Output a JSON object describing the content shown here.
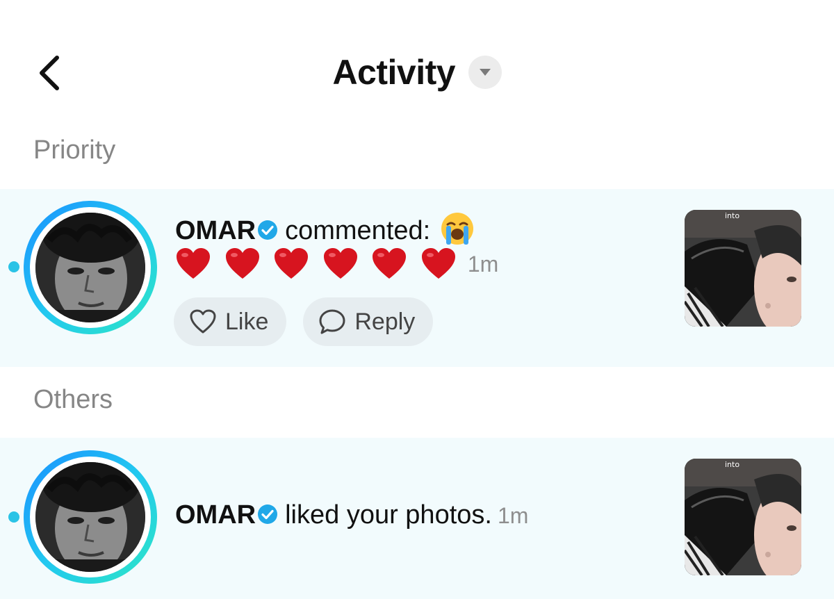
{
  "header": {
    "title": "Activity",
    "back_icon": "chevron-left-icon",
    "dropdown_icon": "caret-down-icon"
  },
  "sections": {
    "priority": "Priority",
    "others": "Others"
  },
  "notifications": [
    {
      "username": "OMAR",
      "verified": true,
      "action": "commented:",
      "emoji": "loudly-crying-face",
      "comment_hearts": 6,
      "time": "1m",
      "thumb_label": "into",
      "buttons": {
        "like": "Like",
        "reply": "Reply"
      }
    },
    {
      "username": "OMAR",
      "verified": true,
      "action": "liked your photos.",
      "time": "1m",
      "thumb_label": "into"
    }
  ],
  "colors": {
    "row_bg": "#f2fbfd",
    "unread_dot": "#2bc3e6",
    "ring_start": "#1a8fff",
    "ring_end": "#2ee6c4",
    "verified": "#20a8e8",
    "heart": "#d7141f",
    "section_label": "#868686"
  }
}
